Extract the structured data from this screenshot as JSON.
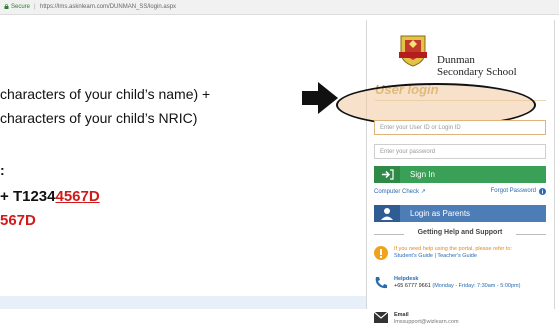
{
  "browser": {
    "secure_label": "Secure",
    "separator": "|",
    "url": "https://lms.asknlearn.com/DUNMAN_SS/login.aspx"
  },
  "slide": {
    "line1": "characters of your child’s name) +",
    "line2": "characters of your child’s NRIC)",
    "line3": ":",
    "line4_plain": "+ ",
    "line4_red_a": "T1234",
    "line4_red_b": "4567D",
    "line5": "567D"
  },
  "login": {
    "school_name_line1": "Dunman",
    "school_name_line2": "Secondary School",
    "title": "User login",
    "userid_placeholder": "Enter your User ID or Login ID",
    "password_placeholder": "Enter your password",
    "signin_label": "Sign In",
    "computer_check": "Computer Check",
    "forgot_password": "Forgot Password",
    "parents_label": "Login as Parents",
    "help_heading": "Getting Help and Support",
    "help_intro": "If you need help using the portal, please refer to:",
    "help_links": "Student's Guide | Teacher's Guide",
    "helpdesk_label": "Helpdesk",
    "helpdesk_phone": "+65 6777 9661",
    "helpdesk_hours": "(Monday - Friday: 7:30am - 5:00pm)",
    "email_label": "Email",
    "email_address": "lmssupport@wizlearn.com"
  },
  "icons": [
    "lock-icon",
    "arrow-right-icon",
    "school-crest-icon",
    "signin-icon",
    "external-link-icon",
    "info-icon",
    "user-icon",
    "alert-icon",
    "phone-icon",
    "mail-icon"
  ],
  "colors": {
    "signin_green": "#3aa057",
    "parents_blue": "#4d7db7",
    "title_gold": "#c9a94d",
    "red_highlight": "#d11a1a"
  }
}
